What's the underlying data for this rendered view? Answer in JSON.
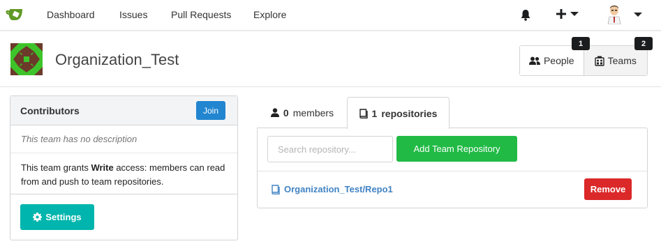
{
  "nav": {
    "items": [
      {
        "label": "Dashboard"
      },
      {
        "label": "Issues"
      },
      {
        "label": "Pull Requests"
      },
      {
        "label": "Explore"
      }
    ],
    "icons": [
      "bell-icon",
      "plus-icon",
      "user-avatar"
    ]
  },
  "org": {
    "name": "Organization_Test",
    "tabs": [
      {
        "label": "People",
        "count": "1"
      },
      {
        "label": "Teams",
        "count": "2"
      }
    ]
  },
  "team": {
    "title": "Contributors",
    "join_label": "Join",
    "description": "This team has no description",
    "access_prefix": "This team grants ",
    "access_level": "Write",
    "access_suffix": " access: members can read from and push to team repositories.",
    "settings_label": "Settings"
  },
  "pane": {
    "members_count": "0",
    "members_label": "members",
    "repos_count": "1",
    "repos_label": "repositories",
    "search_placeholder": "Search repository...",
    "add_repo_label": "Add Team Repository",
    "repos": [
      {
        "name": "Organization_Test/Repo1",
        "remove_label": "Remove"
      }
    ]
  },
  "colors": {
    "primary": "#2185d0",
    "teal": "#00b5ad",
    "green": "#21ba45",
    "red": "#db2828",
    "link": "#4183c4",
    "logo_green": "#609926"
  }
}
